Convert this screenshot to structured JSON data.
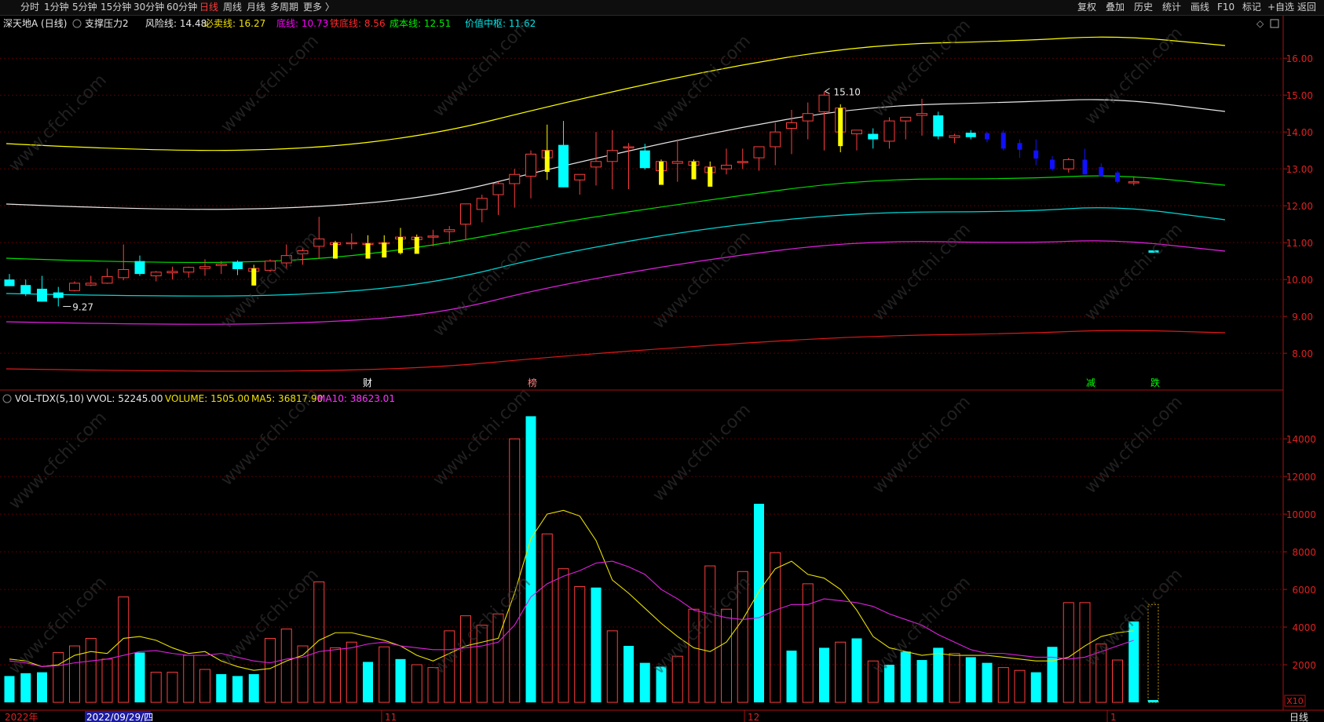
{
  "toolbar": {
    "left": [
      {
        "label": "分时",
        "active": false
      },
      {
        "label": "1分钟",
        "active": false
      },
      {
        "label": "5分钟",
        "active": false
      },
      {
        "label": "15分钟",
        "active": false
      },
      {
        "label": "30分钟",
        "active": false
      },
      {
        "label": "60分钟",
        "active": false
      },
      {
        "label": "日线",
        "active": true
      },
      {
        "label": "周线",
        "active": false
      },
      {
        "label": "月线",
        "active": false
      },
      {
        "label": "多周期",
        "active": false
      },
      {
        "label": "更多 〉",
        "active": false
      }
    ],
    "right": [
      "复权",
      "叠加",
      "历史",
      "统计",
      "画线",
      "F10",
      "标记",
      "+自选",
      "返回"
    ]
  },
  "price_header": {
    "stock": "深天地A (日线)",
    "indicator": "支撑压力2",
    "items": [
      {
        "label": "风险线: 14.48",
        "color": "#e8e8e8"
      },
      {
        "label": "必卖线: 16.27",
        "color": "#f0e000"
      },
      {
        "label": "底线: 10.73",
        "color": "#ff00ff"
      },
      {
        "label": "铁底线: 8.56",
        "color": "#ff2a2a"
      },
      {
        "label": "成本线: 12.51",
        "color": "#00ee00"
      },
      {
        "label": "价值中枢: 11.62",
        "color": "#00e8e8"
      }
    ]
  },
  "volume_header": {
    "indicator": "VOL-TDX(5,10)",
    "items": [
      {
        "label": "VVOL: 52245.00",
        "color": "#e8e8e8"
      },
      {
        "label": "VOLUME: 1505.00",
        "color": "#f0e000"
      },
      {
        "label": "MA5: 36817.90",
        "color": "#f0e000"
      },
      {
        "label": "MA10: 38623.01",
        "color": "#ff33ff"
      }
    ]
  },
  "colors": {
    "up": "#ff3d3d",
    "down": "#00ffff",
    "yellow": "#ffff00",
    "blue": "#1010ff",
    "white": "#e6e6e6",
    "green": "#00dd00",
    "cyan": "#00d8d8",
    "magenta": "#e020e0",
    "red": "#e01818",
    "axis": "#c01010"
  },
  "price_axis": [
    "16.00",
    "15.00",
    "14.00",
    "13.00",
    "12.00",
    "11.00",
    "10.00",
    "9.00",
    "8.00"
  ],
  "volume_axis": [
    "14000",
    "12000",
    "10000",
    "8000",
    "6000",
    "4000",
    "2000"
  ],
  "volume_unit": "X10",
  "bottom": {
    "year": "2022年",
    "date": "2022/09/29/四",
    "months": [
      "11",
      "12",
      "1"
    ],
    "period": "日线"
  },
  "event_markers": [
    {
      "text": "财",
      "color": "#ffffff"
    },
    {
      "text": "榜",
      "color": "#ff8080"
    },
    {
      "text": "减",
      "color": "#00ff00"
    },
    {
      "text": "跌",
      "color": "#00ff00"
    }
  ],
  "annotations": {
    "high": "15.10",
    "low": "9.27"
  },
  "watermark": "www.cfchi.com",
  "chart_data": {
    "type": "candlestick",
    "count": 70,
    "ohlc": [
      [
        10.0,
        10.15,
        9.9,
        9.82
      ],
      [
        9.85,
        10.0,
        9.55,
        9.62
      ],
      [
        9.75,
        10.1,
        9.4,
        9.4
      ],
      [
        9.65,
        9.8,
        9.27,
        9.5
      ],
      [
        9.7,
        9.95,
        9.68,
        9.9
      ],
      [
        9.85,
        10.1,
        9.82,
        9.9
      ],
      [
        9.9,
        10.3,
        9.88,
        10.08
      ],
      [
        10.05,
        10.95,
        9.98,
        10.27
      ],
      [
        10.5,
        10.65,
        10.1,
        10.15
      ],
      [
        10.1,
        10.23,
        9.95,
        10.2
      ],
      [
        10.18,
        10.35,
        10.0,
        10.22
      ],
      [
        10.2,
        10.35,
        10.05,
        10.33
      ],
      [
        10.3,
        10.55,
        10.1,
        10.35
      ],
      [
        10.38,
        10.5,
        10.15,
        10.42
      ],
      [
        10.48,
        10.52,
        10.12,
        10.28
      ],
      [
        10.3,
        10.4,
        10.05,
        10.22
      ],
      [
        10.25,
        10.55,
        10.2,
        10.5
      ],
      [
        10.45,
        10.95,
        10.3,
        10.65
      ],
      [
        10.7,
        10.85,
        10.4,
        10.78
      ],
      [
        10.9,
        11.7,
        10.55,
        11.1
      ],
      [
        11.0,
        11.05,
        10.7,
        10.95
      ],
      [
        10.97,
        11.25,
        10.82,
        11.0
      ],
      [
        10.98,
        11.2,
        10.82,
        10.95
      ],
      [
        11.0,
        11.2,
        10.6,
        10.98
      ],
      [
        11.15,
        11.4,
        10.68,
        11.1
      ],
      [
        11.15,
        11.22,
        10.82,
        11.08
      ],
      [
        11.15,
        11.35,
        10.9,
        11.18
      ],
      [
        11.3,
        11.45,
        10.95,
        11.35
      ],
      [
        11.5,
        11.9,
        11.1,
        12.05
      ],
      [
        11.9,
        12.3,
        11.55,
        12.2
      ],
      [
        12.3,
        12.65,
        11.75,
        12.6
      ],
      [
        12.6,
        13.0,
        11.95,
        12.85
      ],
      [
        12.8,
        13.5,
        12.2,
        13.4
      ],
      [
        13.5,
        14.2,
        12.7,
        13.3
      ],
      [
        13.65,
        14.3,
        12.5,
        12.5
      ],
      [
        12.7,
        12.8,
        12.3,
        12.85
      ],
      [
        13.05,
        14.0,
        12.55,
        13.2
      ],
      [
        13.2,
        14.05,
        12.45,
        13.5
      ],
      [
        13.6,
        13.7,
        12.45,
        13.6
      ],
      [
        13.5,
        13.68,
        12.98,
        13.02
      ],
      [
        13.2,
        13.25,
        12.6,
        12.95
      ],
      [
        13.15,
        13.8,
        12.65,
        13.2
      ],
      [
        13.2,
        13.25,
        12.9,
        13.1
      ],
      [
        13.05,
        13.2,
        12.85,
        12.9
      ],
      [
        13.0,
        13.55,
        12.85,
        13.1
      ],
      [
        13.2,
        13.55,
        13.0,
        13.2
      ],
      [
        13.3,
        13.45,
        12.95,
        13.6
      ],
      [
        13.6,
        14.25,
        13.1,
        14.0
      ],
      [
        14.1,
        14.6,
        13.4,
        14.25
      ],
      [
        14.3,
        14.8,
        13.8,
        14.5
      ],
      [
        14.55,
        15.1,
        13.5,
        15.0
      ],
      [
        14.65,
        14.75,
        13.45,
        14.0
      ],
      [
        13.95,
        14.05,
        13.5,
        14.05
      ],
      [
        13.95,
        14.1,
        13.55,
        13.8
      ],
      [
        13.75,
        14.4,
        13.55,
        14.3
      ],
      [
        14.3,
        14.4,
        13.8,
        14.4
      ],
      [
        14.45,
        14.9,
        13.9,
        14.5
      ],
      [
        14.45,
        14.55,
        13.8,
        13.88
      ],
      [
        13.85,
        13.95,
        13.7,
        13.9
      ],
      [
        13.98,
        14.05,
        13.8,
        13.86
      ],
      [
        13.97,
        14.0,
        13.72,
        13.8
      ],
      [
        13.98,
        14.05,
        13.5,
        13.55
      ],
      [
        13.7,
        13.8,
        13.3,
        13.52
      ],
      [
        13.5,
        13.8,
        13.1,
        13.28
      ],
      [
        13.25,
        13.35,
        12.95,
        13.0
      ],
      [
        13.0,
        13.3,
        12.9,
        13.25
      ],
      [
        13.25,
        13.55,
        12.85,
        12.85
      ],
      [
        13.05,
        13.15,
        12.8,
        12.8
      ],
      [
        12.9,
        12.95,
        12.6,
        12.65
      ],
      [
        12.65,
        12.8,
        12.55,
        12.65
      ]
    ],
    "volume": [
      [
        1400,
        "d"
      ],
      [
        1550,
        "d"
      ],
      [
        1600,
        "d"
      ],
      [
        2650,
        "u"
      ],
      [
        3000,
        "u"
      ],
      [
        3400,
        "u"
      ],
      [
        2300,
        "u"
      ],
      [
        5600,
        "u"
      ],
      [
        2650,
        "d"
      ],
      [
        1600,
        "u"
      ],
      [
        1600,
        "u"
      ],
      [
        2500,
        "u"
      ],
      [
        1750,
        "u"
      ],
      [
        1500,
        "d"
      ],
      [
        1400,
        "d"
      ],
      [
        1500,
        "d"
      ],
      [
        3400,
        "u"
      ],
      [
        3900,
        "u"
      ],
      [
        3000,
        "u"
      ],
      [
        6400,
        "u"
      ],
      [
        2900,
        "u"
      ],
      [
        3200,
        "u"
      ],
      [
        2150,
        "d"
      ],
      [
        2950,
        "u"
      ],
      [
        2300,
        "d"
      ],
      [
        2000,
        "u"
      ],
      [
        1850,
        "u"
      ],
      [
        3800,
        "u"
      ],
      [
        4600,
        "u"
      ],
      [
        4100,
        "u"
      ],
      [
        4700,
        "u"
      ],
      [
        14000,
        "u"
      ],
      [
        15200,
        "d"
      ],
      [
        8950,
        "u"
      ],
      [
        7100,
        "u"
      ],
      [
        6150,
        "u"
      ],
      [
        6100,
        "d"
      ],
      [
        3800,
        "u"
      ],
      [
        3000,
        "d"
      ],
      [
        2100,
        "d"
      ],
      [
        1900,
        "d"
      ],
      [
        2450,
        "u"
      ],
      [
        4950,
        "u"
      ],
      [
        7250,
        "u"
      ],
      [
        4950,
        "u"
      ],
      [
        6950,
        "u"
      ],
      [
        10550,
        "d"
      ],
      [
        7950,
        "u"
      ],
      [
        2750,
        "d"
      ],
      [
        6300,
        "u"
      ],
      [
        2900,
        "d"
      ],
      [
        3200,
        "u"
      ],
      [
        3400,
        "d"
      ],
      [
        2200,
        "u"
      ],
      [
        2000,
        "d"
      ],
      [
        2700,
        "d"
      ],
      [
        2250,
        "d"
      ],
      [
        2900,
        "d"
      ],
      [
        2600,
        "u"
      ],
      [
        2400,
        "d"
      ],
      [
        2100,
        "d"
      ],
      [
        1850,
        "u"
      ],
      [
        1700,
        "u"
      ],
      [
        1600,
        "d"
      ],
      [
        2950,
        "d"
      ],
      [
        5300,
        "u"
      ],
      [
        5300,
        "u"
      ],
      [
        3100,
        "u"
      ],
      [
        2250,
        "u"
      ],
      [
        4300,
        "d"
      ]
    ],
    "ma5": [
      2300,
      2200,
      1900,
      2000,
      2500,
      2700,
      2600,
      3400,
      3500,
      3300,
      2900,
      2600,
      2700,
      2200,
      1900,
      1700,
      1800,
      2200,
      2500,
      3300,
      3700,
      3700,
      3500,
      3300,
      3000,
      2500,
      2200,
      2600,
      3000,
      3200,
      3400,
      5800,
      8700,
      10000,
      10200,
      9900,
      8600,
      6500,
      5800,
      5000,
      4200,
      3500,
      2900,
      2700,
      3200,
      4400,
      5900,
      7100,
      7500,
      6800,
      6600,
      6000,
      4900,
      3500,
      2900,
      2700,
      2500,
      2600,
      2500,
      2500,
      2500,
      2400,
      2300,
      2200,
      2200,
      2400,
      3000,
      3500,
      3700,
      3800
    ],
    "ma10": [
      2200,
      2100,
      1900,
      1950,
      2100,
      2200,
      2300,
      2500,
      2700,
      2750,
      2600,
      2500,
      2500,
      2600,
      2400,
      2200,
      2100,
      2300,
      2400,
      2700,
      2800,
      2900,
      3100,
      3200,
      3000,
      2900,
      2800,
      2800,
      2900,
      3000,
      3200,
      4100,
      5600,
      6300,
      6700,
      7000,
      7400,
      7500,
      7200,
      6800,
      6000,
      5500,
      4900,
      4700,
      4500,
      4400,
      4500,
      4900,
      5200,
      5200,
      5500,
      5400,
      5300,
      5100,
      4700,
      4400,
      4100,
      3600,
      3200,
      2800,
      2600,
      2600,
      2500,
      2400,
      2400,
      2300,
      2400,
      2700,
      3000,
      3300
    ]
  }
}
